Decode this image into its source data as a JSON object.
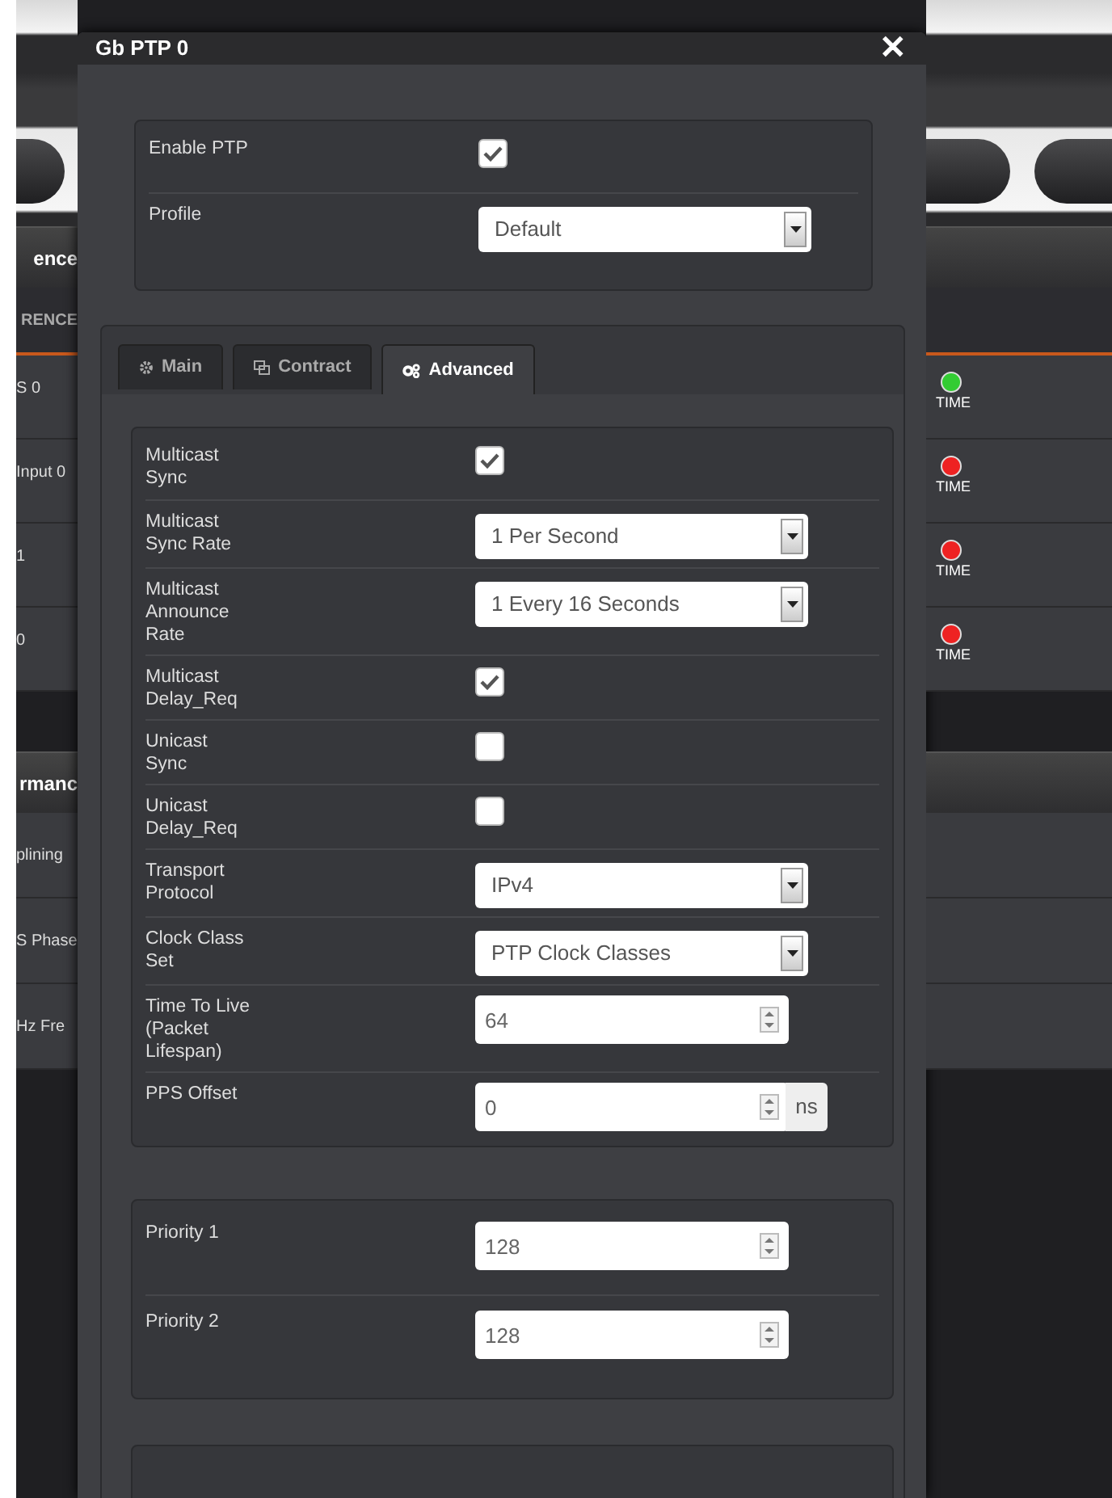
{
  "background": {
    "bands": [
      {
        "kind": "header",
        "text": "ence"
      },
      {
        "kind": "subheader",
        "text": "RENCE"
      },
      {
        "kind": "row",
        "text": "S 0",
        "status": {
          "color": "#33cc33",
          "label": "TIME"
        }
      },
      {
        "kind": "row",
        "text": "Input 0",
        "status": {
          "color": "#ee2222",
          "label": "TIME"
        }
      },
      {
        "kind": "row",
        "text": "1",
        "status": {
          "color": "#ee2222",
          "label": "TIME"
        }
      },
      {
        "kind": "row",
        "text": "0",
        "status": {
          "color": "#ee2222",
          "label": "TIME"
        }
      },
      {
        "kind": "header",
        "text": "rmanc"
      },
      {
        "kind": "row",
        "text": "plining"
      },
      {
        "kind": "row",
        "text": "S Phase"
      },
      {
        "kind": "row",
        "text": "Hz Fre"
      }
    ]
  },
  "dialog": {
    "title": "Gb PTP 0",
    "close": "✕",
    "general": [
      {
        "kind": "checkbox",
        "label": "Enable PTP",
        "checked": true
      },
      {
        "kind": "select",
        "label": "Profile",
        "value": "Default"
      }
    ],
    "tabs": [
      {
        "label": "Main",
        "selected": false
      },
      {
        "label": "Contract",
        "selected": false
      },
      {
        "label": "Advanced",
        "selected": true
      }
    ],
    "settings": [
      {
        "kind": "checkbox",
        "label": "Multicast Sync",
        "checked": true
      },
      {
        "kind": "select",
        "label": "Multicast Sync Rate",
        "value": "1 Per Second"
      },
      {
        "kind": "select",
        "label": "Multicast Announce Rate",
        "value": "1 Every 16 Seconds"
      },
      {
        "kind": "checkbox",
        "label": "Multicast Delay_Req",
        "checked": true
      },
      {
        "kind": "checkbox",
        "label": "Unicast Sync",
        "checked": false
      },
      {
        "kind": "checkbox",
        "label": "Unicast Delay_Req",
        "checked": false
      },
      {
        "kind": "select",
        "label": "Transport Protocol",
        "value": "IPv4"
      },
      {
        "kind": "select",
        "label": "Clock Class Set",
        "value": "PTP Clock Classes"
      },
      {
        "kind": "number",
        "label": "Time To Live (Packet Lifespan)",
        "value": "64"
      },
      {
        "kind": "number",
        "label": "PPS Offset",
        "value": "0",
        "unit": "ns"
      }
    ],
    "priorities": [
      {
        "kind": "number",
        "label": "Priority 1",
        "value": "128"
      },
      {
        "kind": "number",
        "label": "Priority 2",
        "value": "128"
      }
    ]
  }
}
